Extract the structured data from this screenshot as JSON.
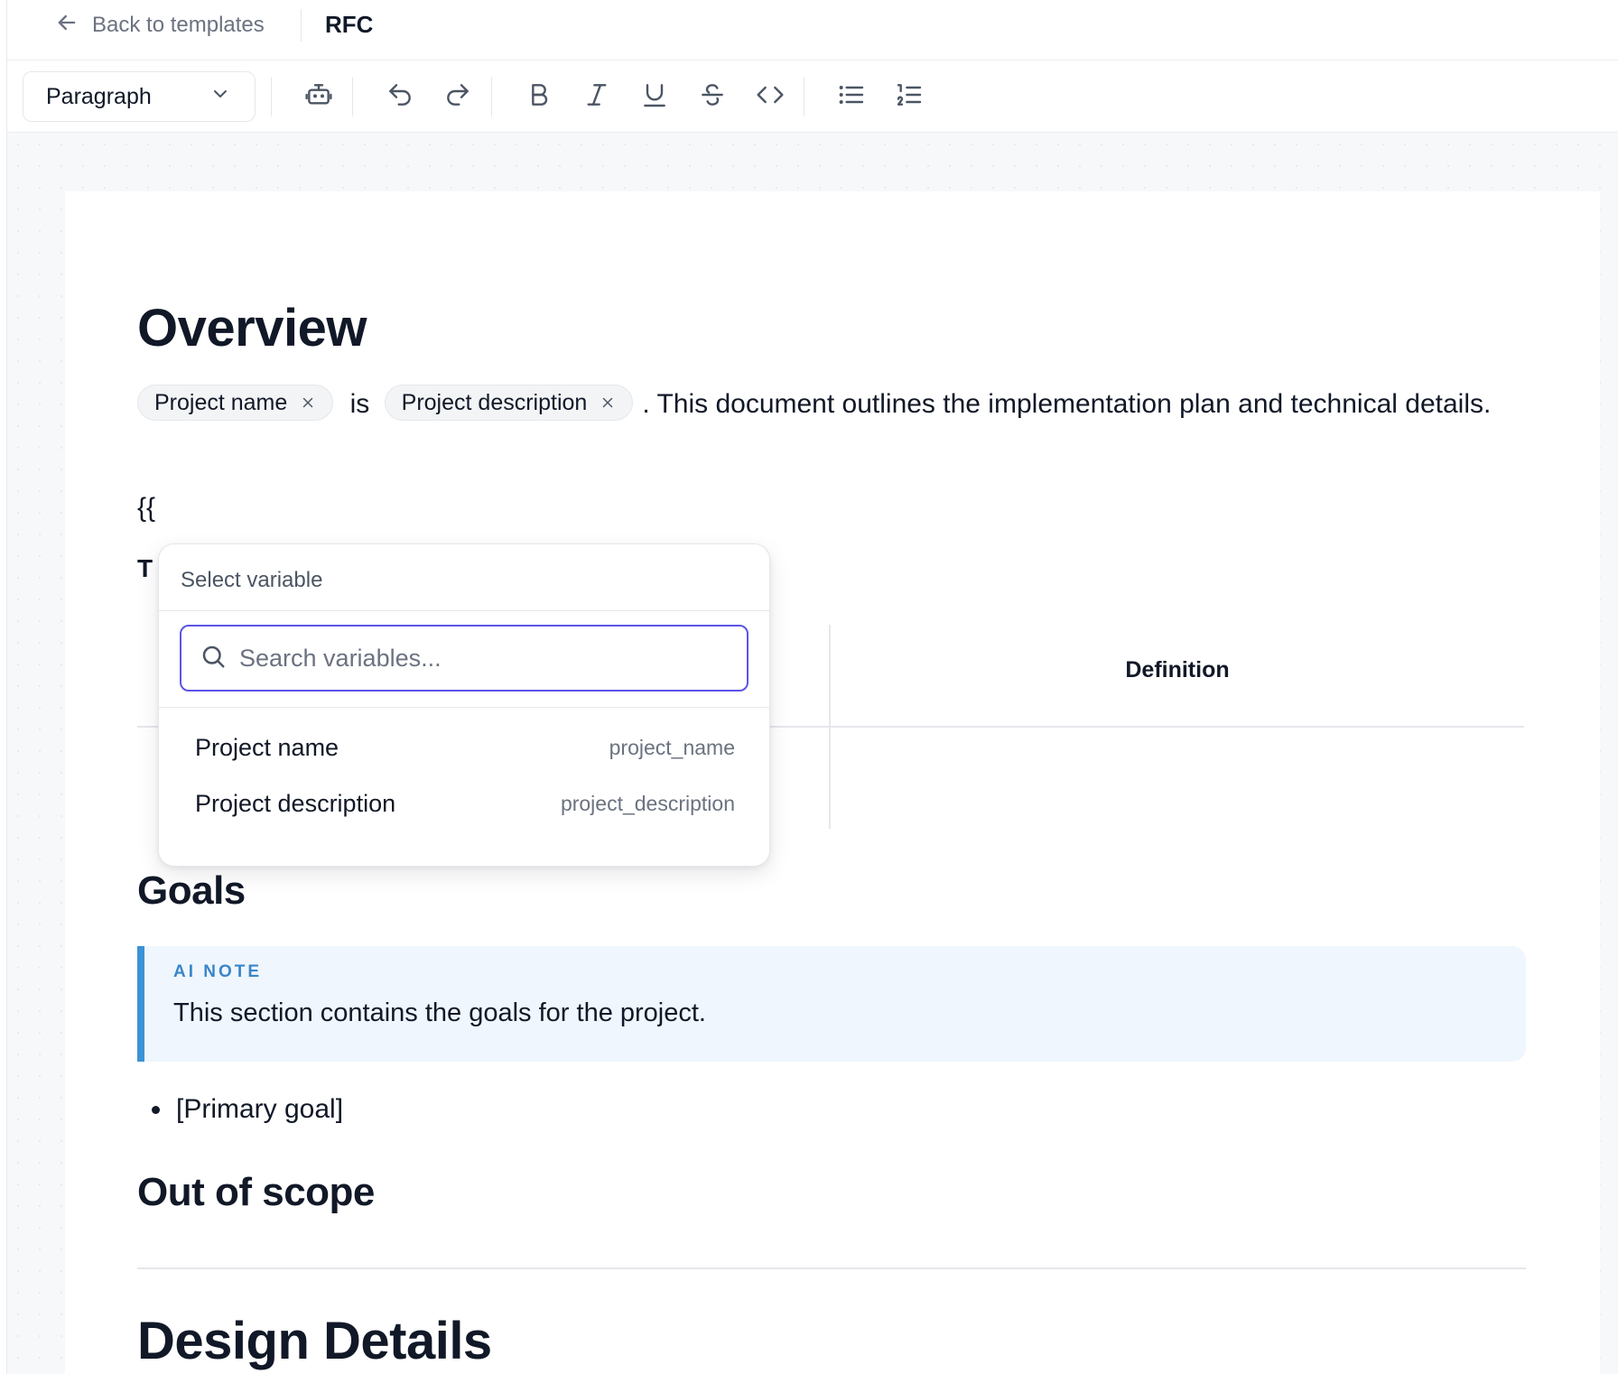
{
  "header": {
    "back_label": "Back to templates",
    "title": "RFC"
  },
  "toolbar": {
    "style_select_value": "Paragraph",
    "buttons": [
      "robot-icon",
      "undo-icon",
      "redo-icon",
      "bold-icon",
      "italic-icon",
      "underline-icon",
      "strikethrough-icon",
      "code-icon",
      "bullet-list-icon",
      "numbered-list-icon"
    ]
  },
  "document": {
    "overview_heading": "Overview",
    "chip_project_name": "Project name",
    "is_text": "is",
    "chip_project_description": "Project description",
    "sentence_rest": ". This document outlines the implementation plan and technical details.",
    "braces": "{{",
    "table_heading_partial": "T",
    "table_definition_header": "Definition",
    "goals_heading": "Goals",
    "ai_note_label": "AI NOTE",
    "ai_note_text": "This section contains the goals for the project.",
    "bullet_primary_goal": "[Primary goal]",
    "out_of_scope_heading": "Out of scope",
    "design_details_heading": "Design Details"
  },
  "variable_popover": {
    "title": "Select variable",
    "search_placeholder": "Search variables...",
    "items": [
      {
        "label": "Project name",
        "key": "project_name"
      },
      {
        "label": "Project description",
        "key": "project_description"
      }
    ]
  },
  "colors": {
    "accent": "#5b54e8",
    "callout_bar": "#3b92d6",
    "callout_bg": "#eff6fd",
    "callout_label": "#3a86c8"
  }
}
